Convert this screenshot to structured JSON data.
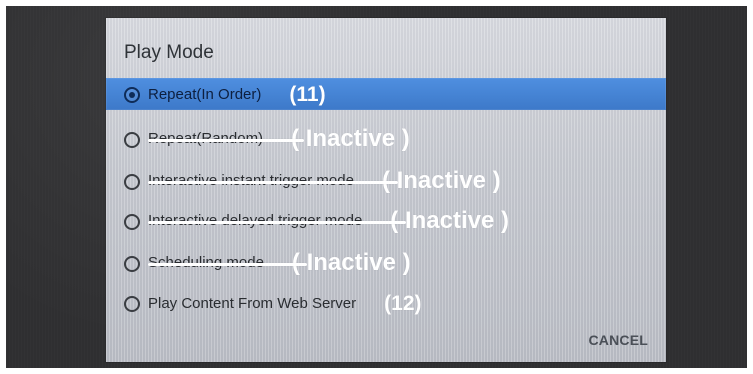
{
  "dialog": {
    "title": "Play Mode",
    "cancel_label": "CANCEL",
    "options": [
      {
        "label": "Repeat(In Order)",
        "status": "(11)",
        "selected": true,
        "strike": false
      },
      {
        "label": "Repeat(Random)",
        "status": "( Inactive )",
        "selected": false,
        "strike": true
      },
      {
        "label": "Interactive instant trigger mode",
        "status": "( Inactive )",
        "selected": false,
        "strike": true
      },
      {
        "label": "Interactive delayed trigger mode",
        "status": "( Inactive )",
        "selected": false,
        "strike": true
      },
      {
        "label": "Scheduling mode",
        "status": "( Inactive )",
        "selected": false,
        "strike": true
      },
      {
        "label": "Play Content From Web Server",
        "status": "(12)",
        "selected": false,
        "strike": false
      }
    ]
  }
}
